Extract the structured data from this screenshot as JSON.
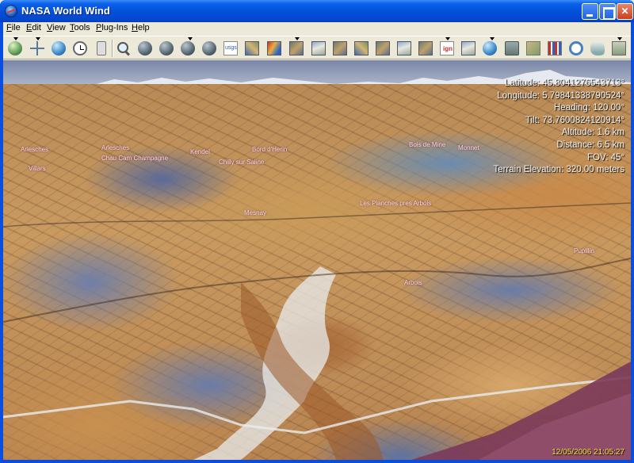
{
  "window": {
    "title": "NASA World Wind"
  },
  "menu": [
    {
      "label": "File",
      "accel": "F",
      "rest": "ile"
    },
    {
      "label": "Edit",
      "accel": "E",
      "rest": "dit"
    },
    {
      "label": "View",
      "accel": "V",
      "rest": "iew"
    },
    {
      "label": "Tools",
      "accel": "T",
      "rest": "ools"
    },
    {
      "label": "Plug-Ins",
      "accel": "P",
      "rest": "lug-Ins"
    },
    {
      "label": "Help",
      "accel": "H",
      "rest": "elp"
    }
  ],
  "toolbar": {
    "icons": [
      "layers-globe-icon",
      "crosshair-icon",
      "blue-globe-icon",
      "clock-icon",
      "phone-icon",
      "search-icon",
      "gray-globe-icon",
      "dark-globe-icon",
      "globe-moon-icon",
      "usgs-icon",
      "landsat-icon",
      "heat-map-icon",
      "topo-map-icon",
      "aerial-icon",
      "satellite-icon",
      "relief-icon",
      "terrain-icon",
      "elevation-icon",
      "ign-icon",
      "overlay-icon",
      "globe-search-icon",
      "toolbox-icon",
      "map-icon",
      "chart-icon",
      "rings-icon",
      "us-map-icon",
      "help-icon"
    ]
  },
  "hud": {
    "latitude": "Latitude: 45.8041276543713°",
    "longitude": "Longitude: 5.79841338790524°",
    "heading": "Heading: 120.00°",
    "tilt": "Tilt: 73.7600824120914°",
    "altitude": "Altitude: 1.6 km",
    "distance": "Distance: 6.5 km",
    "fov": "FOV: 45°",
    "terrain": "Terrain Elevation: 320.00 meters"
  },
  "placenames": [
    "Arlesches",
    "Chau Cam Champagne",
    "Kendel",
    "Chilly sur Saline",
    "Bord d'Herin",
    "Vesoul",
    "Villars",
    "Mesnay",
    "Les Planches pres Arbois",
    "Pupillin",
    "Arbois",
    "Bois de Mine",
    "Monnet"
  ],
  "status": {
    "datetime": "12/05/2006 21:05:27"
  },
  "colors": {
    "titlebar": "#0350d8",
    "hud_text": "#f4f4f4",
    "datetime_text": "#f0e040",
    "placename_text": "#ffd6e6"
  }
}
